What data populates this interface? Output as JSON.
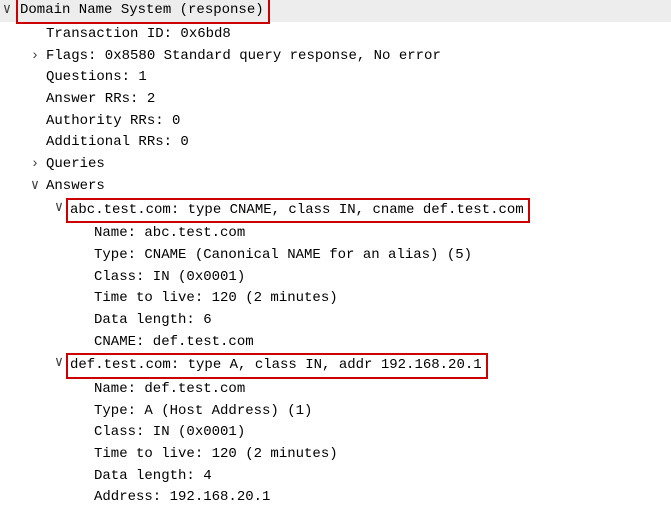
{
  "header": {
    "title": "Domain Name System (response)"
  },
  "fields": {
    "transaction_id": "Transaction ID: 0x6bd8",
    "flags": "Flags: 0x8580 Standard query response, No error",
    "questions": "Questions: 1",
    "answer_rrs": "Answer RRs: 2",
    "authority_rrs": "Authority RRs: 0",
    "additional_rrs": "Additional RRs: 0",
    "queries_label": "Queries",
    "answers_label": "Answers"
  },
  "answers": [
    {
      "summary": "abc.test.com: type CNAME, class IN, cname def.test.com",
      "name": "Name: abc.test.com",
      "type": "Type: CNAME (Canonical NAME for an alias) (5)",
      "class": "Class: IN (0x0001)",
      "ttl": "Time to live: 120 (2 minutes)",
      "datalen": "Data length: 6",
      "value": "CNAME: def.test.com"
    },
    {
      "summary": "def.test.com: type A, class IN, addr 192.168.20.1",
      "name": "Name: def.test.com",
      "type": "Type: A (Host Address) (1)",
      "class": "Class: IN (0x0001)",
      "ttl": "Time to live: 120 (2 minutes)",
      "datalen": "Data length: 4",
      "value": "Address: 192.168.20.1"
    }
  ],
  "glyphs": {
    "expanded": "∨",
    "collapsed": "›"
  }
}
